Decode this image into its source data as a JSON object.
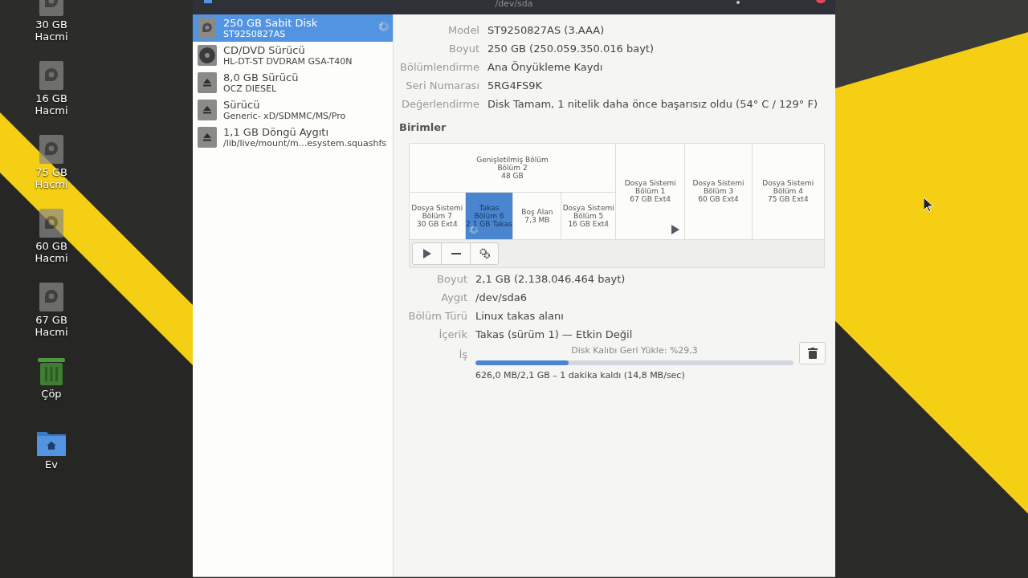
{
  "desktop_icons": [
    {
      "kind": "disk",
      "label": "30 GB\nHacmi"
    },
    {
      "kind": "disk",
      "label": "16 GB\nHacmi"
    },
    {
      "kind": "disk",
      "label": "75 GB\nHacmi"
    },
    {
      "kind": "disk",
      "label": "60 GB\nHacmi"
    },
    {
      "kind": "disk",
      "label": "67 GB\nHacmi"
    },
    {
      "kind": "trash",
      "label": "Çöp"
    },
    {
      "kind": "home",
      "label": "Ev"
    }
  ],
  "window": {
    "title": "/dev/sda"
  },
  "devices": [
    {
      "kind": "disk",
      "name": "250 GB Sabit Disk",
      "detail": "ST9250827AS",
      "selected": true,
      "busy": true
    },
    {
      "kind": "optical",
      "name": "CD/DVD Sürücü",
      "detail": "HL-DT-ST DVDRAM GSA-T40N",
      "selected": false,
      "busy": false
    },
    {
      "kind": "eject",
      "name": "8,0 GB Sürücü",
      "detail": "OCZ DIESEL",
      "selected": false,
      "busy": false
    },
    {
      "kind": "eject",
      "name": "Sürücü",
      "detail": "Generic- xD/SDMMC/MS/Pro",
      "selected": false,
      "busy": false
    },
    {
      "kind": "eject",
      "name": "1,1 GB Döngü Aygıtı",
      "detail": "/lib/live/mount/m...esystem.squashfs",
      "selected": false,
      "busy": false
    }
  ],
  "disk_info": [
    {
      "label": "Model",
      "value": "ST9250827AS (3.AAA)"
    },
    {
      "label": "Boyut",
      "value": "250 GB (250.059.350.016 bayt)"
    },
    {
      "label": "Bölümlendirme",
      "value": "Ana Önyükleme Kaydı"
    },
    {
      "label": "Seri Numarası",
      "value": "5RG4FS9K"
    },
    {
      "label": "Değerlendirme",
      "value": "Disk Tamam, 1 nitelik daha önce başarısız oldu (54° C / 129° F)"
    }
  ],
  "volumes_heading": "Birimler",
  "volumes": [
    {
      "lines": [
        "Genişletilmiş Bölüm",
        "Bölüm 2",
        "48 GB"
      ],
      "selected": false,
      "busy": false,
      "mounted": false,
      "children": [
        {
          "lines": [
            "Dosya Sistemi",
            "Bölüm 7",
            "30 GB Ext4"
          ],
          "selected": false,
          "busy": false,
          "mounted": false
        },
        {
          "lines": [
            "Takas",
            "Bölüm 6",
            "2,1 GB Takas"
          ],
          "selected": true,
          "busy": true,
          "mounted": false
        },
        {
          "lines": [
            "Boş Alan",
            "7,3 MB"
          ],
          "selected": false,
          "busy": false,
          "mounted": false
        },
        {
          "lines": [
            "Dosya Sistemi",
            "Bölüm 5",
            "16 GB Ext4"
          ],
          "selected": false,
          "busy": false,
          "mounted": false
        }
      ]
    },
    {
      "lines": [
        "Dosya Sistemi",
        "Bölüm 1",
        "67 GB Ext4"
      ],
      "selected": false,
      "busy": false,
      "mounted": true
    },
    {
      "lines": [
        "Dosya Sistemi",
        "Bölüm 3",
        "60 GB Ext4"
      ],
      "selected": false,
      "busy": false,
      "mounted": false
    },
    {
      "lines": [
        "Dosya Sistemi",
        "Bölüm 4",
        "75 GB Ext4"
      ],
      "selected": false,
      "busy": false,
      "mounted": false
    }
  ],
  "volume_info": [
    {
      "label": "Boyut",
      "value": "2,1 GB (2.138.046.464 bayt)"
    },
    {
      "label": "Aygıt",
      "value": "/dev/sda6"
    },
    {
      "label": "Bölüm Türü",
      "value": "Linux takas alanı"
    },
    {
      "label": "İçerik",
      "value": "Takas (sürüm 1) — Etkin Değil"
    }
  ],
  "job": {
    "label": "İş",
    "title": "Disk Kalıbı Geri Yükle: %29,3",
    "level": 0.293,
    "status": "626,0 MB/2,1 GB – 1 dakika kaldı (14,8 MB/sec)"
  }
}
